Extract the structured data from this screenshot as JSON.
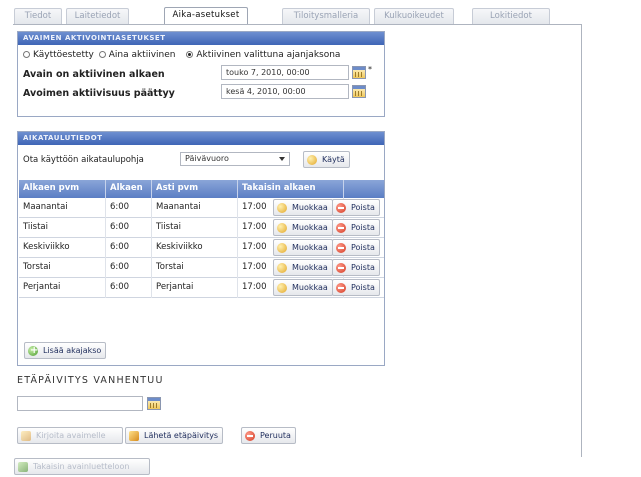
{
  "tabs": [
    {
      "label": "Tiedot",
      "active": false
    },
    {
      "label": "Laitetiedot",
      "active": false
    },
    {
      "label": "Aika-asetukset",
      "active": true
    },
    {
      "label": "Tiloitysmalleria",
      "active": false
    },
    {
      "label": "Kulkuoikeudet",
      "active": false
    },
    {
      "label": "Lokitiedot",
      "active": false
    }
  ],
  "activation": {
    "header": "Avaimen aktivointiasetukset",
    "radios": [
      {
        "label": "Käyttöestetty",
        "selected": false
      },
      {
        "label": "Aina aktiivinen",
        "selected": false
      },
      {
        "label": "Aktiivinen valittuna ajanjaksona",
        "selected": true
      }
    ],
    "start_label": "Avain on aktiivinen alkaen",
    "start_value": "touko 7, 2010, 00:00",
    "required_mark": "*",
    "end_label": "Avoimen aktiivisuus päättyy",
    "end_value": "kesä 4, 2010, 00:00"
  },
  "schedule": {
    "header": "Aikataulutiedot",
    "template_label": "Ota käyttöön aikataulupohja",
    "template_value": "Päivävuoro",
    "apply_label": "Käytä",
    "columns": [
      "Alkaen pvm",
      "Alkaen",
      "Asti pvm",
      "Takaisin alkaen"
    ],
    "rows": [
      {
        "start_day": "Maanantai",
        "start_time": "6:00",
        "end_day": "Maanantai",
        "end_time": "17:00"
      },
      {
        "start_day": "Tiistai",
        "start_time": "6:00",
        "end_day": "Tiistai",
        "end_time": "17:00"
      },
      {
        "start_day": "Keskiviikko",
        "start_time": "6:00",
        "end_day": "Keskiviikko",
        "end_time": "17:00"
      },
      {
        "start_day": "Torstai",
        "start_time": "6:00",
        "end_day": "Torstai",
        "end_time": "17:00"
      },
      {
        "start_day": "Perjantai",
        "start_time": "6:00",
        "end_day": "Perjantai",
        "end_time": "17:00"
      }
    ],
    "edit_label": "Muokkaa",
    "delete_label": "Poista",
    "add_label": "Lisää akajakso"
  },
  "remote": {
    "title": "Etäpäivitys vanhentuu",
    "value": "",
    "create_label": "Kirjoita avaimelle",
    "send_label": "Lähetä etäpäivitys",
    "cancel_label": "Peruuta"
  },
  "footer": {
    "back_label": "Takaisin avainluetteloon"
  }
}
